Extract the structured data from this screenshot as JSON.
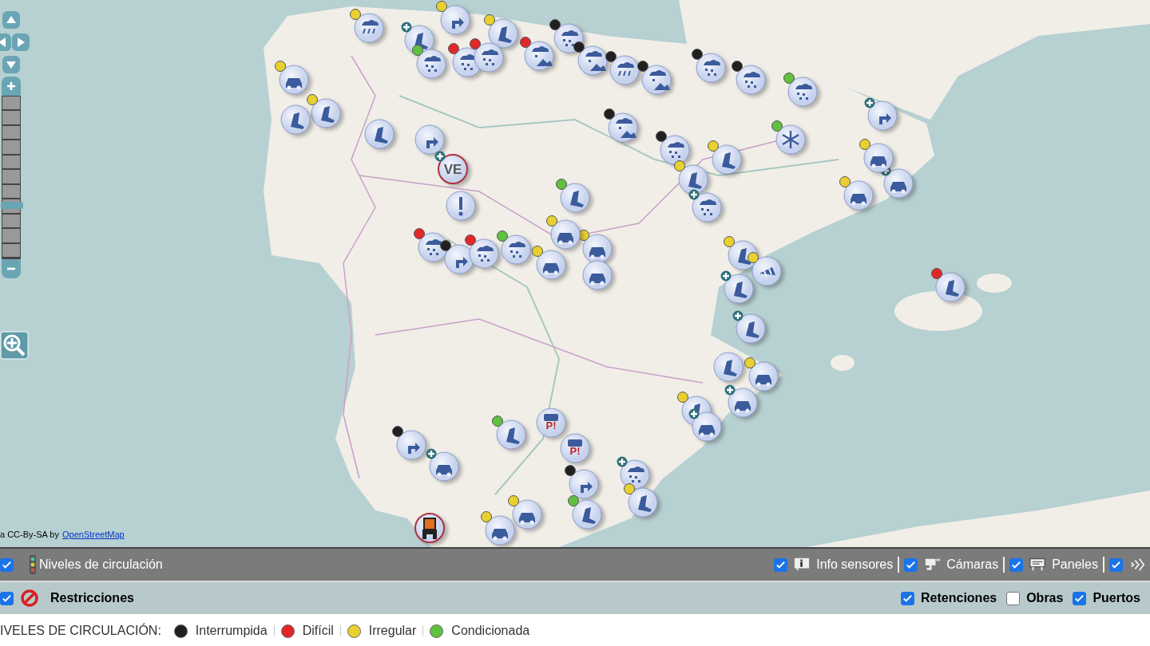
{
  "map": {
    "kind": "picture",
    "controls": {
      "zoom": {
        "level": 0.33
      }
    },
    "markers": [
      {
        "kind": "rain",
        "color": "#e8d030",
        "plus": false
      },
      {
        "kind": "turn",
        "color": "#e8d030",
        "plus": false
      },
      {
        "kind": "chain",
        "plus": true
      },
      {
        "kind": "chain",
        "color": "#e8d030",
        "plus": false
      },
      {
        "kind": "snow",
        "color": "#60c040",
        "plus": false
      },
      {
        "kind": "snow",
        "color": "#e02828",
        "plus": false
      },
      {
        "kind": "snow",
        "color": "#e02828",
        "plus": false
      },
      {
        "kind": "mountain",
        "color": "#e02828",
        "plus": false
      },
      {
        "kind": "snow",
        "color": "#202020",
        "plus": false
      },
      {
        "kind": "mountain",
        "color": "#202020",
        "plus": false
      },
      {
        "kind": "rain",
        "color": "#202020",
        "plus": false
      },
      {
        "kind": "mountain",
        "color": "#202020",
        "plus": false
      },
      {
        "kind": "snow",
        "color": "#202020",
        "plus": false
      },
      {
        "kind": "snow",
        "color": "#202020",
        "plus": false
      },
      {
        "kind": "snow",
        "color": "#60c040",
        "plus": false
      },
      {
        "kind": "car",
        "color": "#e8d030",
        "plus": false
      },
      {
        "kind": "chain",
        "color": "#e8d030",
        "plus": false
      },
      {
        "kind": "chain",
        "plus": false
      },
      {
        "kind": "chain",
        "plus": false
      },
      {
        "kind": "turn",
        "plus": false
      },
      {
        "kind": "ve",
        "label": "VE",
        "plus": true
      },
      {
        "kind": "warning",
        "plus": false
      },
      {
        "kind": "mountain",
        "color": "#202020",
        "plus": false
      },
      {
        "kind": "snow",
        "color": "#202020",
        "plus": false
      },
      {
        "kind": "chain",
        "color": "#e8d030",
        "plus": false
      },
      {
        "kind": "chain",
        "color": "#e8d030",
        "plus": false
      },
      {
        "kind": "snow",
        "plus": true
      },
      {
        "kind": "snowflake",
        "color": "#60c040",
        "plus": false
      },
      {
        "kind": "turn",
        "plus": true
      },
      {
        "kind": "car",
        "plus": true
      },
      {
        "kind": "car",
        "color": "#e8d030",
        "plus": false
      },
      {
        "kind": "car",
        "color": "#e8d030",
        "plus": false
      },
      {
        "kind": "chain",
        "color": "#60c040",
        "plus": false
      },
      {
        "kind": "snow",
        "color": "#e02828",
        "plus": false
      },
      {
        "kind": "turn",
        "color": "#202020",
        "plus": false
      },
      {
        "kind": "snow",
        "color": "#e02828",
        "plus": false
      },
      {
        "kind": "snow",
        "color": "#60c040",
        "plus": false
      },
      {
        "kind": "car",
        "color": "#e8d030",
        "plus": false
      },
      {
        "kind": "car",
        "color": "#e8d030",
        "plus": false
      },
      {
        "kind": "car",
        "color": "#e8d030",
        "plus": false
      },
      {
        "kind": "car",
        "plus": false
      },
      {
        "kind": "chain",
        "color": "#e8d030",
        "plus": false
      },
      {
        "kind": "cone",
        "color": "#e8d030",
        "plus": false
      },
      {
        "kind": "chain",
        "plus": true
      },
      {
        "kind": "chain",
        "plus": true
      },
      {
        "kind": "chain",
        "plus": false
      },
      {
        "kind": "car",
        "color": "#e8d030",
        "plus": false
      },
      {
        "kind": "chain",
        "color": "#e8d030",
        "plus": false
      },
      {
        "kind": "car",
        "plus": true
      },
      {
        "kind": "car",
        "plus": true
      },
      {
        "kind": "chain",
        "color": "#60c040",
        "plus": false
      },
      {
        "kind": "parking",
        "label": "P!",
        "plus": false
      },
      {
        "kind": "parking",
        "label": "P!",
        "plus": false
      },
      {
        "kind": "turn",
        "color": "#202020",
        "plus": false
      },
      {
        "kind": "car",
        "plus": true
      },
      {
        "kind": "turn",
        "color": "#202020",
        "plus": false
      },
      {
        "kind": "snow",
        "plus": true
      },
      {
        "kind": "chain",
        "color": "#e8d030",
        "plus": false
      },
      {
        "kind": "chain",
        "color": "#60c040",
        "plus": false
      },
      {
        "kind": "car",
        "color": "#e8d030",
        "plus": false
      },
      {
        "kind": "car",
        "color": "#e8d030",
        "plus": false
      },
      {
        "kind": "tractor",
        "plus": false
      },
      {
        "kind": "chain",
        "color": "#e02828",
        "plus": false
      }
    ],
    "attribution": {
      "text": "a CC-By-SA by",
      "link": "OpenStreetMap"
    }
  },
  "layers_bar": [
    {
      "kind": "traffic",
      "label": "Niveles de circulación",
      "checked": true
    },
    {
      "kind": "sensor",
      "label": "Info sensores",
      "checked": true
    },
    {
      "kind": "camera",
      "label": "Cámaras",
      "checked": true
    },
    {
      "kind": "panel",
      "label": "Paneles",
      "checked": true
    },
    {
      "kind": "more",
      "checked": true
    }
  ],
  "filters_bar": {
    "left": [
      {
        "kind": "restriction",
        "label": "Restricciones",
        "checked": true
      }
    ],
    "right": [
      {
        "label": "Retenciones",
        "checked": true
      },
      {
        "label": "Obras",
        "checked": false
      },
      {
        "label": "Puertos",
        "checked": true
      }
    ]
  },
  "legend": {
    "title": "IVELES DE CIRCULACIÓN:",
    "items": [
      {
        "label": "Interrumpida",
        "color": "#202020"
      },
      {
        "label": "Difícil",
        "color": "#e02828"
      },
      {
        "label": "Irregular",
        "color": "#e8d030"
      },
      {
        "label": "Condicionada",
        "color": "#60c040"
      }
    ]
  }
}
